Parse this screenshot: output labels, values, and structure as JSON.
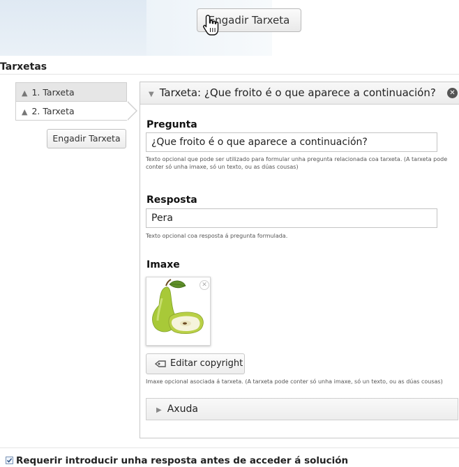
{
  "top_button": {
    "label": "Engadir Tarxeta"
  },
  "section": {
    "title": "Tarxetas"
  },
  "card_list": {
    "items": [
      {
        "label": "1. Tarxeta"
      },
      {
        "label": "2. Tarxeta"
      }
    ],
    "add_button_label": "Engadir Tarxeta"
  },
  "panel": {
    "header": "Tarxeta: ¿Que froito é o que aparece a continuación?",
    "question": {
      "label": "Pregunta",
      "value": "¿Que froito é o que aparece a continuación?",
      "help": "Texto opcional que pode ser utilizado para formular unha pregunta relacionada coa tarxeta. (A tarxeta pode conter só unha imaxe, só un texto, ou as dúas cousas)"
    },
    "answer": {
      "label": "Resposta",
      "value": "Pera",
      "help": "Texto opcional coa resposta á pregunta formulada."
    },
    "image": {
      "label": "Imaxe",
      "copyright_button": "Editar copyright",
      "help": "Imaxe opcional asociada á tarxeta. (A tarxeta pode conter só unha imaxe, só un texto, ou as dúas cousas)"
    },
    "help_section": {
      "label": "Axuda"
    }
  },
  "require_answer": {
    "label": "Requerir introducir unha resposta antes de acceder á solución",
    "checked": true
  }
}
